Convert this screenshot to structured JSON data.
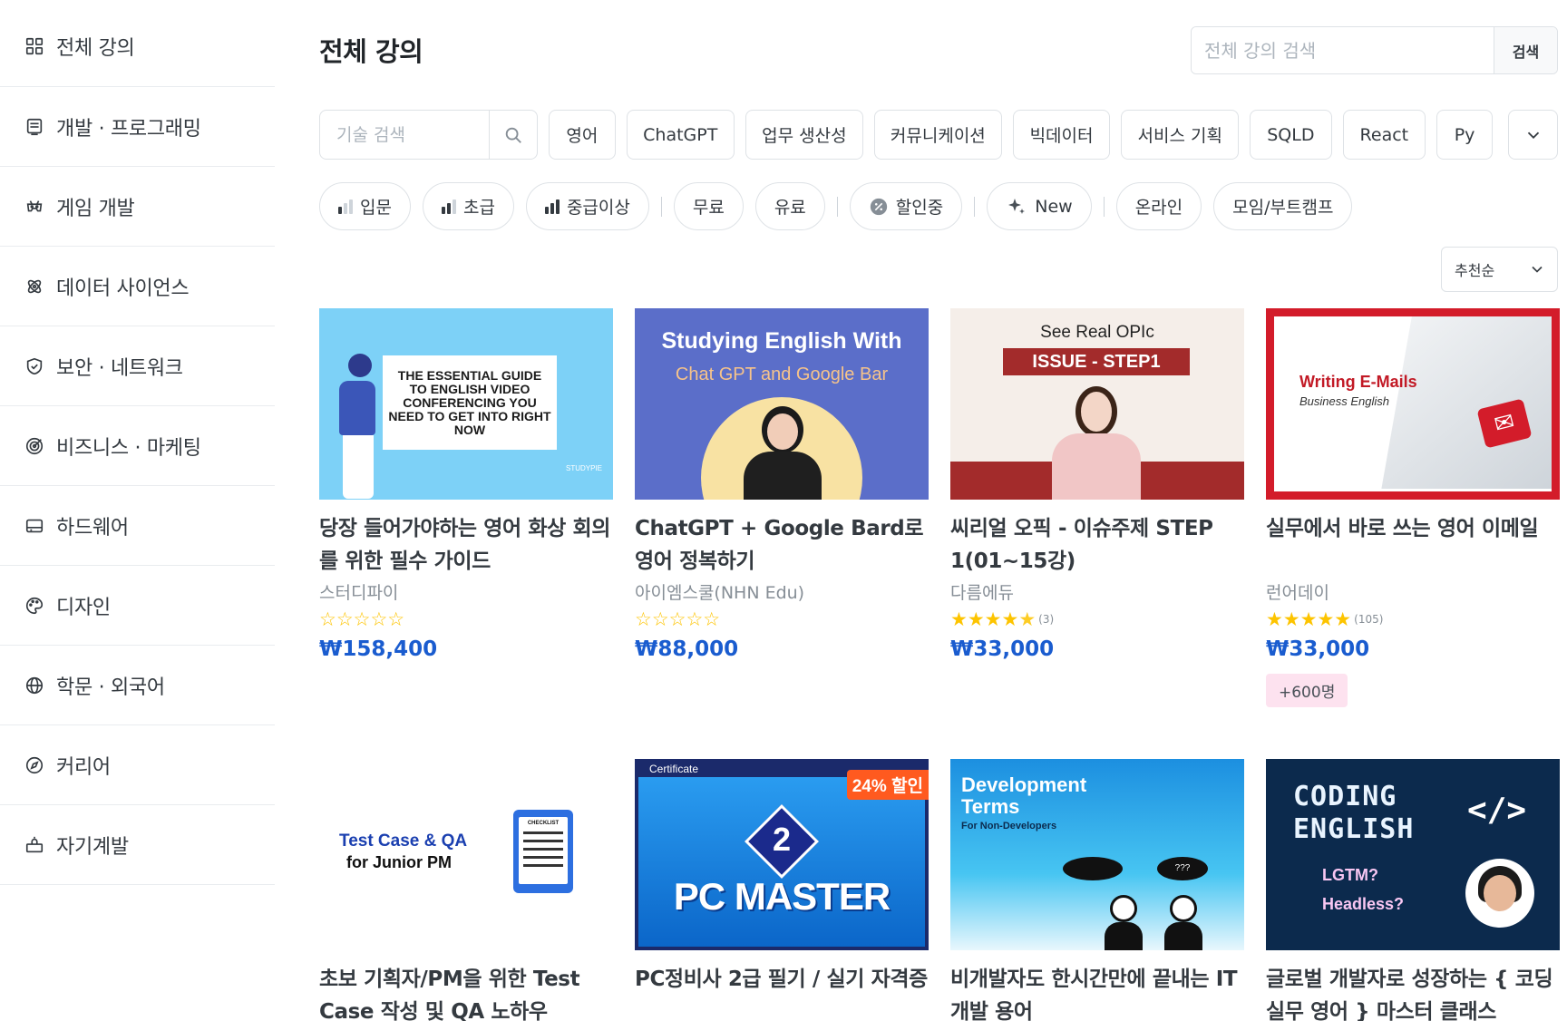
{
  "sidebar": {
    "items": [
      {
        "label": "전체 강의",
        "icon": "grid-icon"
      },
      {
        "label": "개발 · 프로그래밍",
        "icon": "monitor-icon"
      },
      {
        "label": "게임 개발",
        "icon": "gamepad-icon"
      },
      {
        "label": "데이터 사이언스",
        "icon": "atom-icon"
      },
      {
        "label": "보안 · 네트워크",
        "icon": "shield-icon"
      },
      {
        "label": "비즈니스 · 마케팅",
        "icon": "target-icon"
      },
      {
        "label": "하드웨어",
        "icon": "hardware-icon"
      },
      {
        "label": "디자인",
        "icon": "palette-icon"
      },
      {
        "label": "학문 · 외국어",
        "icon": "globe-icon"
      },
      {
        "label": "커리어",
        "icon": "compass-icon"
      },
      {
        "label": "자기계발",
        "icon": "lightbulb-icon"
      }
    ]
  },
  "header": {
    "title": "전체 강의",
    "search_placeholder": "전체 강의 검색",
    "search_button": "검색"
  },
  "skills": {
    "search_placeholder": "기술 검색",
    "chips": [
      "영어",
      "ChatGPT",
      "업무 생산성",
      "커뮤니케이션",
      "빅데이터",
      "서비스 기획",
      "SQLD",
      "React",
      "Py"
    ]
  },
  "filters": {
    "levels": [
      {
        "label": "입문",
        "level": 1
      },
      {
        "label": "초급",
        "level": 2
      },
      {
        "label": "중급이상",
        "level": 3
      }
    ],
    "price": [
      "무료",
      "유료"
    ],
    "discount": "할인중",
    "new": "New",
    "format": [
      "온라인",
      "모임/부트캠프"
    ]
  },
  "sort": {
    "selected": "추천순"
  },
  "thumbnails": {
    "c1": {
      "title": "THE ESSENTIAL GUIDE TO ENGLISH VIDEO CONFERENCING YOU NEED TO GET INTO RIGHT NOW",
      "brand": "STUDYPIE"
    },
    "c2": {
      "line1": "Studying English With",
      "line2": "Chat GPT and Google Bar"
    },
    "c3": {
      "line1": "See Real OPIc",
      "line2": "ISSUE - STEP1"
    },
    "c4": {
      "line1": "Writing E-Mails",
      "line2": "Business English"
    },
    "c5": {
      "line1": "Test Case & QA",
      "line2": "for Junior PM",
      "tag": "CHECKLIST"
    },
    "c6": {
      "label": "Certificate",
      "discount": "24% 할인",
      "number": "2",
      "title": "PC MASTER"
    },
    "c7": {
      "line1": "Development",
      "line2": "Terms",
      "line3": "For Non-Developers",
      "bubble": "???"
    },
    "c8": {
      "line1": "CODING",
      "line2": "ENGLISH",
      "line3": "LGTM?",
      "line4": "Headless?",
      "code": "</>"
    }
  },
  "courses": [
    {
      "title": "당장 들어가야하는 영어 화상 회의를 위한 필수 가이드",
      "instructor": "스터디파이",
      "rating": 0,
      "reviews": "",
      "price": "₩158,400",
      "badge": ""
    },
    {
      "title": "ChatGPT + Google Bard로 영어 정복하기",
      "instructor": "아이엠스쿨(NHN Edu)",
      "rating": 0,
      "reviews": "",
      "price": "₩88,000",
      "badge": ""
    },
    {
      "title": "씨리얼 오픽 - 이슈주제 STEP 1(01~15강)",
      "instructor": "다름에듀",
      "rating": 4.5,
      "reviews": "(3)",
      "price": "₩33,000",
      "badge": ""
    },
    {
      "title": "실무에서 바로 쓰는 영어 이메일",
      "instructor": "런어데이",
      "rating": 5,
      "reviews": "(105)",
      "price": "₩33,000",
      "badge": "+600명"
    },
    {
      "title": "초보 기획자/PM을 위한 Test Case 작성 및 QA 노하우",
      "instructor": "",
      "rating": 0,
      "reviews": "",
      "price": "",
      "badge": ""
    },
    {
      "title": "PC정비사 2급 필기 / 실기 자격증",
      "instructor": "",
      "rating": 0,
      "reviews": "",
      "price": "",
      "badge": ""
    },
    {
      "title": "비개발자도 한시간만에 끝내는 IT 개발 용어",
      "instructor": "",
      "rating": 0,
      "reviews": "",
      "price": "",
      "badge": ""
    },
    {
      "title": "글로벌 개발자로 성장하는 { 코딩 실무 영어 } 마스터 클래스",
      "instructor": "",
      "rating": 0,
      "reviews": "",
      "price": "",
      "badge": ""
    }
  ],
  "colors": {
    "price": "#1a5ccf",
    "star": "#fdc400",
    "badge_bg": "#fde2ef"
  }
}
